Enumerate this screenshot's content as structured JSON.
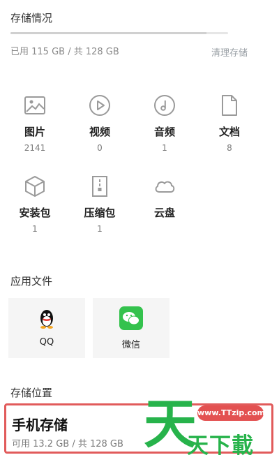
{
  "storage": {
    "title": "存储情况",
    "usage_text": "已用 115 GB / 共 128 GB",
    "used_fraction": 0.9,
    "clean_label": "清理存储"
  },
  "categories": [
    {
      "label": "图片",
      "count": "2141",
      "icon": "image-icon"
    },
    {
      "label": "视频",
      "count": "0",
      "icon": "video-play-icon"
    },
    {
      "label": "音频",
      "count": "1",
      "icon": "music-note-icon"
    },
    {
      "label": "文档",
      "count": "8",
      "icon": "document-icon"
    },
    {
      "label": "安装包",
      "count": "1",
      "icon": "package-box-icon"
    },
    {
      "label": "压缩包",
      "count": "1",
      "icon": "zip-archive-icon"
    },
    {
      "label": "云盘",
      "count": "",
      "icon": "cloud-icon"
    }
  ],
  "app_files": {
    "title": "应用文件",
    "apps": [
      {
        "name": "QQ",
        "icon": "qq-penguin-icon"
      },
      {
        "name": "微信",
        "icon": "wechat-icon"
      }
    ]
  },
  "location": {
    "title": "存储位置",
    "name": "手机存储",
    "detail": "可用 13.2 GB / 共 128 GB"
  },
  "watermark": {
    "url": "www.TTzip.com",
    "big_char": "天",
    "text": "天下載"
  },
  "colors": {
    "highlight_border": "#e15b5b",
    "watermark_green": "#27b34b",
    "wechat_green": "#34c24d"
  }
}
